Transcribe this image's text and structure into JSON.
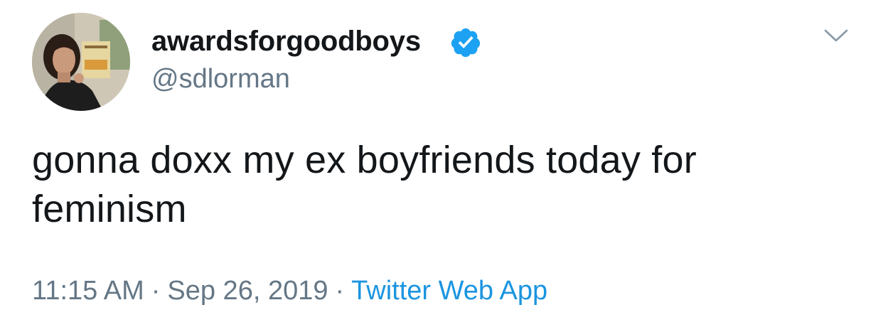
{
  "tweet": {
    "display_name": "awardsforgoodboys",
    "handle": "@sdlorman",
    "verified": true,
    "text": "gonna doxx my ex boyfriends today for feminism",
    "time": "11:15 AM",
    "separator": "·",
    "date": "Sep 26, 2019",
    "source": "Twitter Web App"
  },
  "icons": {
    "avatar": "profile-photo",
    "verified": "verified-badge-icon",
    "menu": "chevron-down-icon"
  },
  "colors": {
    "text": "#14171a",
    "secondary": "#657786",
    "link": "#1b95e0",
    "verified": "#1da1f2"
  }
}
